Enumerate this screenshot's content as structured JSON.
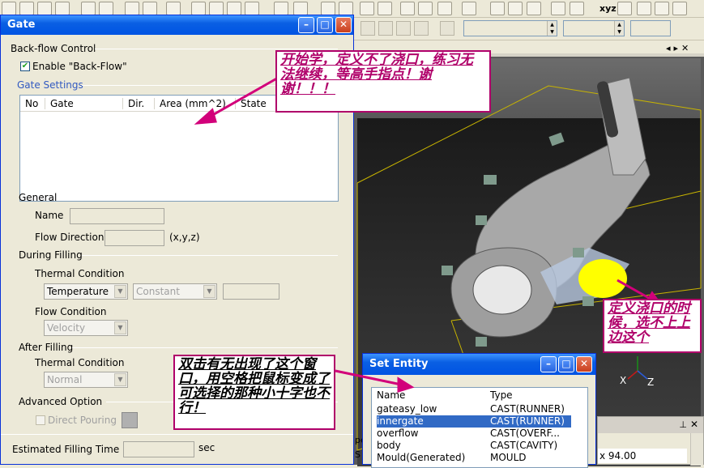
{
  "gate_dialog": {
    "title": "Gate",
    "backflow_control": "Back-flow Control",
    "enable_backflow": "Enable \"Back-Flow\"",
    "enable_backflow_checked": true,
    "gate_settings": "Gate Settings",
    "table_columns": [
      "No",
      "Gate",
      "Dir.",
      "Area (mm^2)",
      "State"
    ],
    "general": "General",
    "name_label": "Name",
    "flow_direction_label": "Flow Direction",
    "flow_direction_unit": "(x,y,z)",
    "during_filling": "During Filling",
    "thermal_condition": "Thermal Condition",
    "thermal_select": "Temperature",
    "thermal_mode_select": "Constant",
    "flow_condition": "Flow Condition",
    "flow_select": "Velocity",
    "after_filling": "After Filling",
    "after_thermal_condition": "Thermal Condition",
    "after_thermal_select": "Normal",
    "advanced_option": "Advanced Option",
    "direct_pouring": "Direct Pouring",
    "estimated_filling_time": "Estimated Filling Time",
    "time_unit": "sec"
  },
  "set_entity_dialog": {
    "title": "Set Entity",
    "columns": [
      "Name",
      "Type"
    ],
    "rows": [
      {
        "name": "gateasy_low",
        "type": "CAST(RUNNER)"
      },
      {
        "name": "innergate",
        "type": "CAST(RUNNER)"
      },
      {
        "name": "overflow",
        "type": "CAST(OVERF..."
      },
      {
        "name": "body",
        "type": "CAST(CAVITY)"
      },
      {
        "name": "Mould(Generated)",
        "type": "MOULD"
      }
    ],
    "selected_row": 1
  },
  "viewport": {
    "axis_x": "X",
    "axis_z": "Z",
    "toolbar_xyz": "xyz"
  },
  "props_panel": {
    "value": "x 94.00",
    "left_fragment_1": "pe",
    "left_fragment_2": "S"
  },
  "annotations": {
    "note_1": "开始学，定义不了浇口，练习无法继续，等高手指点！谢谢！！！",
    "note_2": "定义浇口的时候，选不上上边这个",
    "note_3": "双击有无出现了这个窗口，用空格把鼠标变成了可选择的那种小十字也不行！"
  },
  "colors": {
    "titlebar": "#0054e3",
    "annotation_border": "#b0006a",
    "annotation_text": "#b0006a",
    "arrow": "#d2007a",
    "gate_marker": "#ffff00"
  }
}
